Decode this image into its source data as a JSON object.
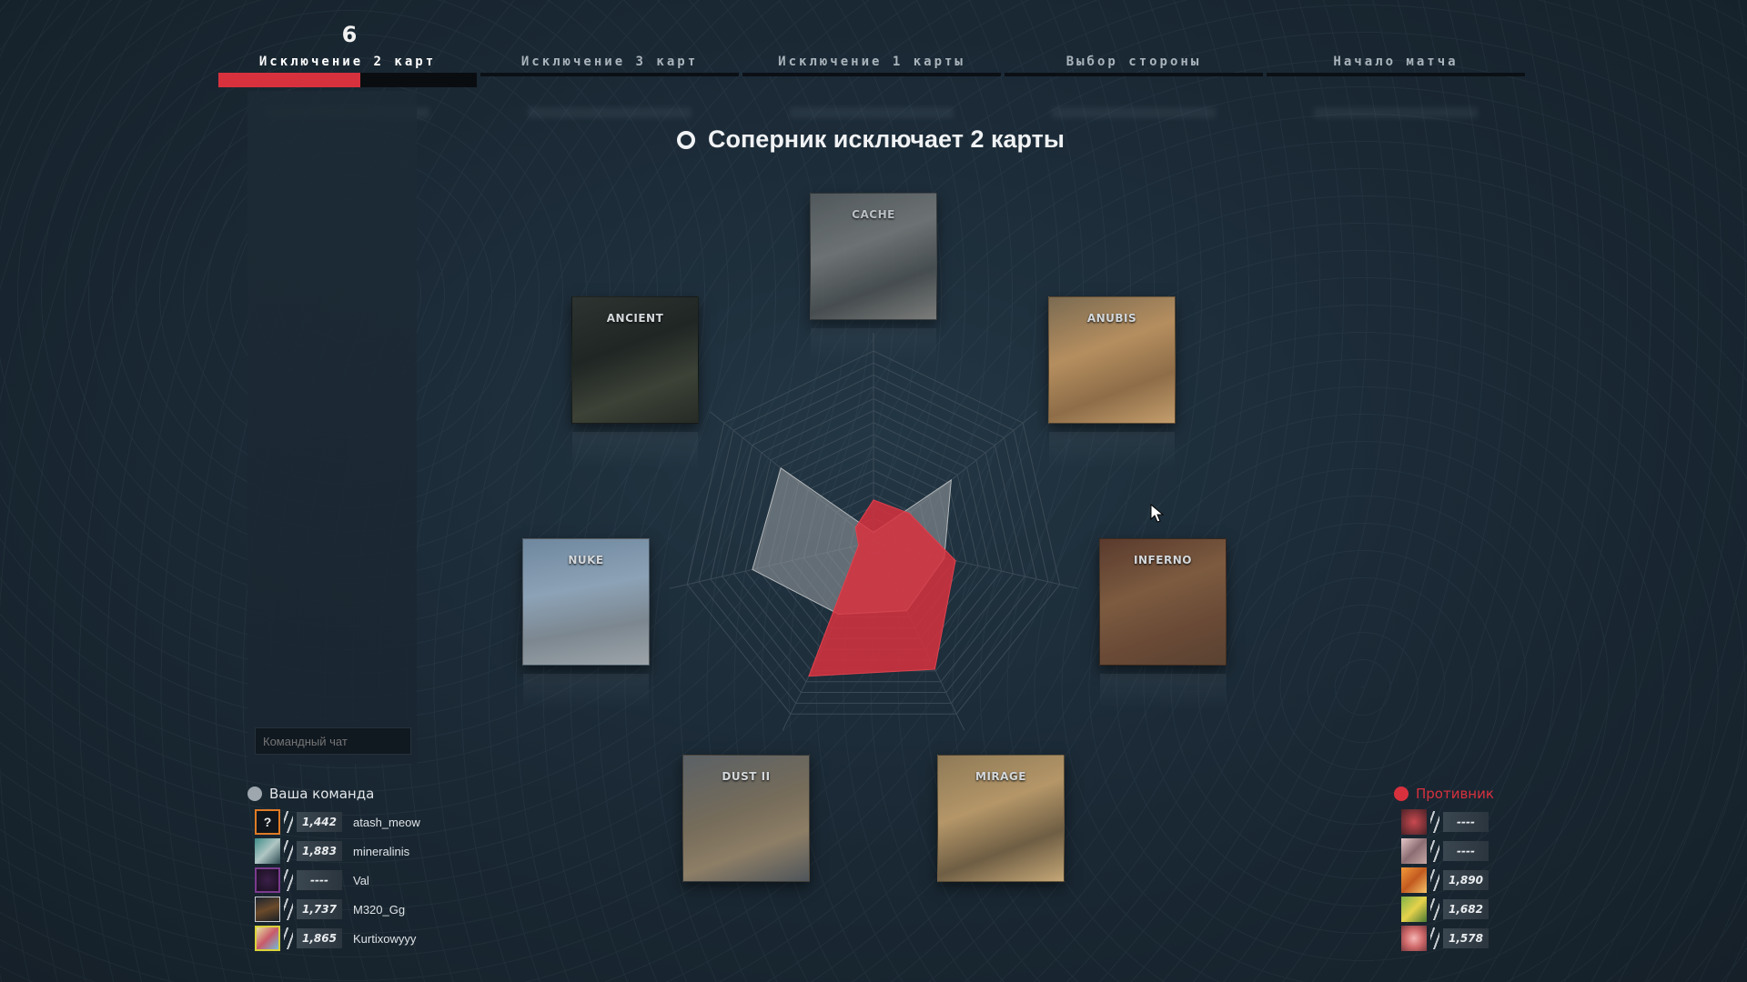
{
  "progress": {
    "counter": "6",
    "steps": [
      {
        "label": "Исключение 2 карт",
        "active": true
      },
      {
        "label": "Исключение 3 карт",
        "active": false
      },
      {
        "label": "Исключение 1 карты",
        "active": false
      },
      {
        "label": "Выбор стороны",
        "active": false
      },
      {
        "label": "Начало матча",
        "active": false
      }
    ]
  },
  "status": {
    "text": "Соперник исключает 2 карты"
  },
  "maps": {
    "cache": "CACHE",
    "ancient": "ANCIENT",
    "anubis": "ANUBIS",
    "nuke": "NUKE",
    "inferno": "INFERNO",
    "dust": "DUST II",
    "mirage": "MIRAGE"
  },
  "radar": {
    "axes": [
      "CACHE",
      "ANUBIS",
      "INFERNO",
      "MIRAGE",
      "DUST II",
      "NUKE",
      "ANCIENT"
    ],
    "own_color": "#d8313e",
    "opponent_color": "#8a8f94"
  },
  "chat": {
    "placeholder": "Командный чат"
  },
  "my_team": {
    "title": "Ваша команда",
    "players": [
      {
        "elo": "1,442",
        "name": "atash_meow",
        "avatar_icon": "question-mark-icon"
      },
      {
        "elo": "1,883",
        "name": "mineralinis",
        "avatar_icon": "character-avatar-icon"
      },
      {
        "elo": "----",
        "name": "Val",
        "avatar_icon": "dark-avatar-icon"
      },
      {
        "elo": "1,737",
        "name": "M320_Gg",
        "avatar_icon": "soldier-avatar-icon"
      },
      {
        "elo": "1,865",
        "name": "Kurtixowyyy",
        "avatar_icon": "anime-avatar-icon"
      }
    ]
  },
  "enemy_team": {
    "title": "Противник",
    "players": [
      {
        "elo": "----"
      },
      {
        "elo": "----"
      },
      {
        "elo": "1,890"
      },
      {
        "elo": "1,682"
      },
      {
        "elo": "1,578"
      }
    ]
  }
}
